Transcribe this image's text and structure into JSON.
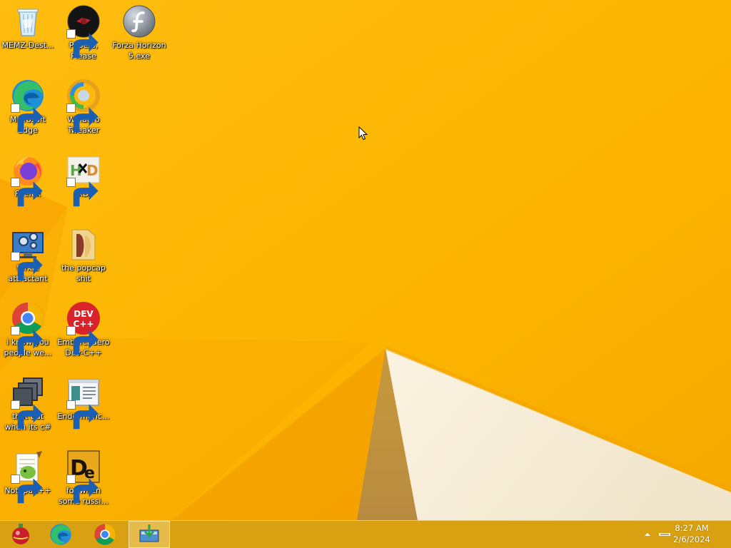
{
  "desktop": {
    "icons": [
      {
        "label": "MEMZ-Dest...",
        "icon": "recycle-bin-icon"
      },
      {
        "label": "Papers, Please",
        "icon": "papers-please-icon"
      },
      {
        "label": "Forza Horizon 5.exe",
        "icon": "flash-player-icon"
      },
      {
        "label": "Microsoft Edge",
        "icon": "edge-icon"
      },
      {
        "label": "Winaero Tweaker",
        "icon": "winaero-icon"
      },
      {
        "label": "Firefox",
        "icon": "firefox-icon"
      },
      {
        "label": "xD",
        "icon": "hxd-icon"
      },
      {
        "label": "forkie attractant",
        "icon": "monitor-gear-icon"
      },
      {
        "label": "the popcap shit",
        "icon": "folder-icon"
      },
      {
        "label": "i know you people we...",
        "icon": "chrome-icon"
      },
      {
        "label": "Embarcadero Dev-C++",
        "icon": "devcpp-icon"
      },
      {
        "label": "that but when its c#",
        "icon": "windows-stack-icon"
      },
      {
        "label": "Endermanc...",
        "icon": "document-window-icon"
      },
      {
        "label": "Notepad++",
        "icon": "notepad-plus-plus-icon"
      },
      {
        "label": "for when some russi...",
        "icon": "de-icon"
      }
    ]
  },
  "taskbar": {
    "items": [
      {
        "name": "ornament-app",
        "icon": "ornament-icon",
        "active": false
      },
      {
        "name": "edge",
        "icon": "edge-icon",
        "active": false
      },
      {
        "name": "chrome",
        "icon": "chrome-icon",
        "active": false
      },
      {
        "name": "installer",
        "icon": "installer-icon",
        "active": true
      }
    ],
    "clock": {
      "time": "8:27 AM",
      "date": "2/6/2024"
    }
  },
  "colors": {
    "wallpaper_main": "#f8b000",
    "wallpaper_light": "#ffc21a",
    "wallpaper_shadow": "#f39a00",
    "paper_white": "#f5ecd8",
    "taskbar": "#d6a014"
  }
}
